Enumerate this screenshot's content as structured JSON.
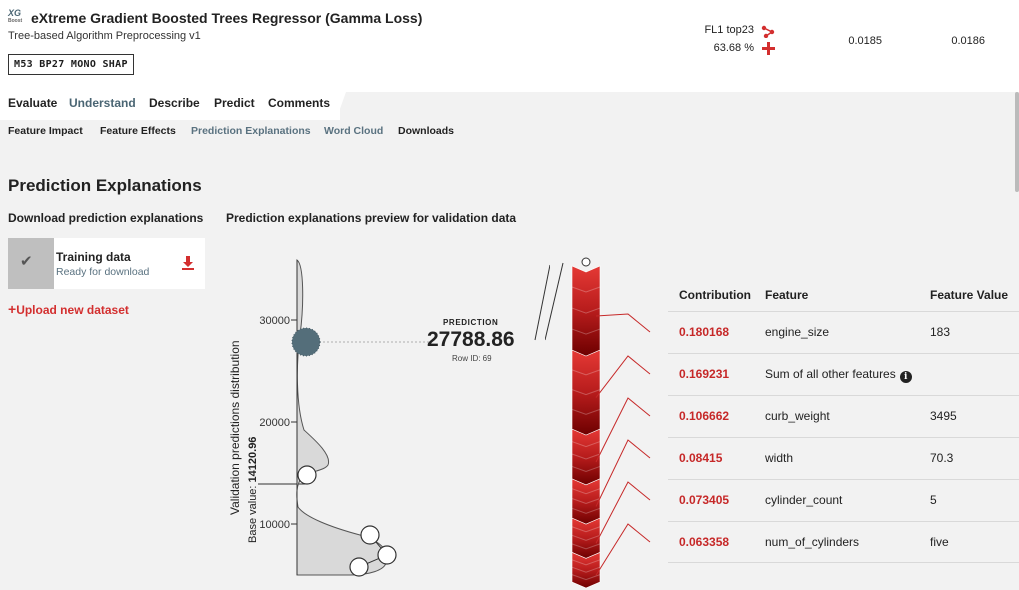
{
  "header": {
    "logo_text": "XG",
    "logo_small": "Boost",
    "title": "eXtreme Gradient Boosted Trees Regressor (Gamma Loss)",
    "subtitle": "Tree-based Algorithm Preprocessing v1",
    "badge": "M53  BP27  MONO  SHAP",
    "metric_label": "FL1 top23",
    "metric_percent": "63.68 %",
    "metric_val1": "0.0185",
    "metric_val2": "0.0186"
  },
  "tabs": [
    {
      "label": "Evaluate",
      "active": false
    },
    {
      "label": "Understand",
      "active": true
    },
    {
      "label": "Describe",
      "active": false
    },
    {
      "label": "Predict",
      "active": false
    },
    {
      "label": "Comments",
      "active": false
    }
  ],
  "subtabs": [
    {
      "label": "Feature Impact",
      "active": false
    },
    {
      "label": "Feature Effects",
      "active": false
    },
    {
      "label": "Prediction Explanations",
      "active": true
    },
    {
      "label": "Word Cloud",
      "active": true
    },
    {
      "label": "Downloads",
      "active": false
    }
  ],
  "section_title": "Prediction Explanations",
  "download_title": "Download prediction explanations",
  "preview_title": "Prediction explanations preview for validation data",
  "card": {
    "title": "Training data",
    "status": "Ready for download",
    "thumb_icon": "check-icon",
    "download_icon": "download-icon"
  },
  "upload_link": "Upload new dataset",
  "chart": {
    "ylabel": "Validation predictions distribution",
    "base_label": "Base value: ",
    "base_value": "14120.96",
    "ticks": [
      "30000",
      "20000",
      "10000"
    ],
    "prediction_label": "PREDICTION",
    "prediction_value": "27788.86",
    "row_id": "Row ID: 69"
  },
  "chart_data": {
    "type": "area",
    "ylabel": "Validation predictions distribution",
    "yticks": [
      30000,
      20000,
      10000
    ],
    "base_value": 14120.96,
    "prediction": 27788.86,
    "contributions": [
      0.180168,
      0.169231,
      0.106662,
      0.08415,
      0.073405,
      0.063358
    ]
  },
  "table": {
    "headers": {
      "contribution": "Contribution",
      "feature": "Feature",
      "value": "Feature Value"
    },
    "rows": [
      {
        "contribution": "0.180168",
        "feature": "engine_size",
        "value": "183",
        "info": false
      },
      {
        "contribution": "0.169231",
        "feature": "Sum of all other features",
        "value": "",
        "info": true
      },
      {
        "contribution": "0.106662",
        "feature": "curb_weight",
        "value": "3495",
        "info": false
      },
      {
        "contribution": "0.08415",
        "feature": "width",
        "value": "70.3",
        "info": false
      },
      {
        "contribution": "0.073405",
        "feature": "cylinder_count",
        "value": "5",
        "info": false
      },
      {
        "contribution": "0.063358",
        "feature": "num_of_cylinders",
        "value": "five",
        "info": false
      }
    ]
  },
  "colors": {
    "accent_red": "#d32f2f",
    "active_tab": "#4a6573",
    "bar_dark": "#8b0000"
  }
}
